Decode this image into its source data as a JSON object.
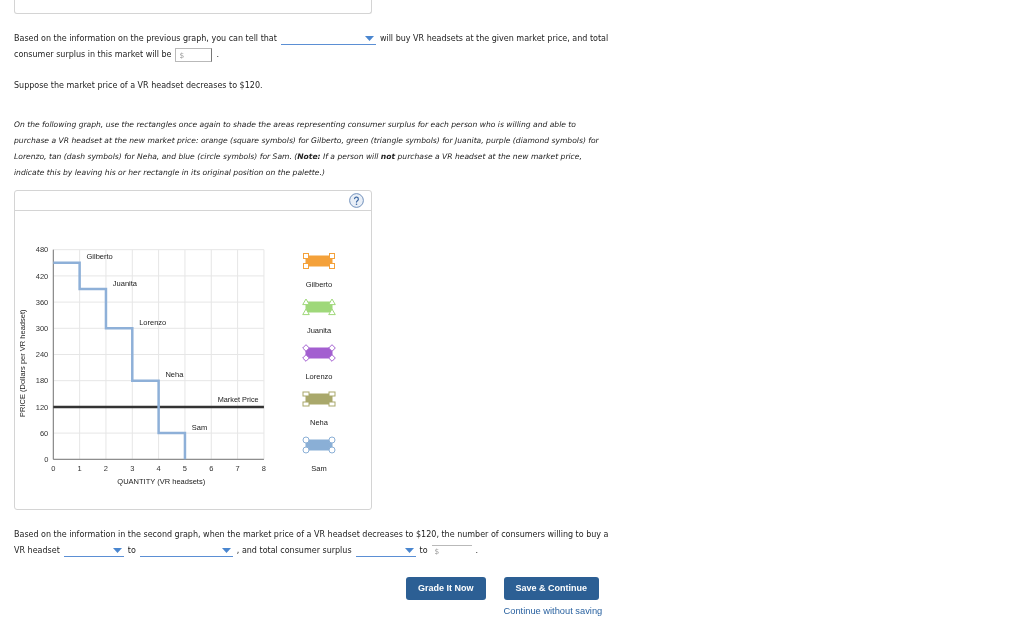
{
  "question_1": {
    "lines": [
      [
        {
          "kind": "text",
          "text": "Based on the information on the previous graph, you can tell that"
        },
        {
          "kind": "dropdown"
        },
        {
          "kind": "text",
          "text": "will buy VR headsets at the given market price, and total"
        }
      ],
      [
        {
          "kind": "text",
          "text": "consumer surplus in this market will be"
        },
        {
          "kind": "input",
          "placeholder": "$"
        },
        {
          "kind": "text",
          "text": "."
        }
      ]
    ]
  },
  "scenario": "Suppose the market price of a VR headset decreases to $120.",
  "instructions": "On the following graph, use the rectangles once again to shade the areas representing consumer surplus for each person who is willing and able to purchase a VR headset at the new market price: orange (square symbols) for Gilberto, green (triangle symbols) for Juanita, purple (diamond symbols) for Lorenzo, tan (dash symbols) for Neha, and blue (circle symbols) for Sam. (**Note:** If a person will **not** purchase a VR headset at the new market price, indicate this by leaving his or her rectangle in its original position on the palette.)",
  "graph_panel": {
    "chart_data": {
      "type": "step",
      "xlabel": "QUANTITY (VR headsets)",
      "ylabel": "PRICE (Dollars per VR headset)",
      "x": [
        0,
        1,
        2,
        3,
        4,
        5
      ],
      "values": [
        450,
        390,
        300,
        180,
        60,
        0
      ],
      "color": "#8eb0d8",
      "xlim": [
        0,
        8
      ],
      "ylim": [
        0,
        480
      ],
      "xticks": [
        0,
        1,
        2,
        3,
        4,
        5,
        6,
        7,
        8
      ],
      "yticks": [
        0,
        60,
        120,
        180,
        240,
        300,
        360,
        420,
        480
      ],
      "grid": true,
      "ref_lines": [
        {
          "axis": "y",
          "value": 120,
          "label": "Market Price",
          "color": "#333333",
          "line_style": "solid"
        }
      ],
      "annotations": [
        "Gilberto",
        "Juanita",
        "Lorenzo",
        "Neha",
        "Sam"
      ]
    },
    "palette": [
      {
        "label": "Gilberto",
        "kind": "square",
        "color": "#f4a13a"
      },
      {
        "label": "Juanita",
        "kind": "triangle",
        "color": "#9fd87a"
      },
      {
        "label": "Lorenzo",
        "kind": "diamond",
        "color": "#a35fd0"
      },
      {
        "label": "Neha",
        "kind": "dash",
        "color": "#a9a86b"
      },
      {
        "label": "Sam",
        "kind": "circle",
        "color": "#8aafd6"
      }
    ]
  },
  "question_2": {
    "lines": [
      [
        {
          "kind": "text",
          "text": "Based on the information in the second graph, when the market price of a VR headset decreases to $120, the number of consumers willing to buy a"
        }
      ],
      [
        {
          "kind": "text",
          "text": "VR headset"
        },
        {
          "kind": "dropdown"
        },
        {
          "kind": "text",
          "text": "to"
        },
        {
          "kind": "dropdown"
        },
        {
          "kind": "text",
          "text": ", and total consumer surplus"
        },
        {
          "kind": "dropdown"
        },
        {
          "kind": "text",
          "text": "to"
        },
        {
          "kind": "input",
          "placeholder": "$"
        },
        {
          "kind": "text",
          "text": "."
        }
      ]
    ]
  },
  "buttons": [
    {
      "label": "Grade It Now"
    },
    {
      "label": "Save & Continue"
    }
  ],
  "link": "Continue without saving"
}
